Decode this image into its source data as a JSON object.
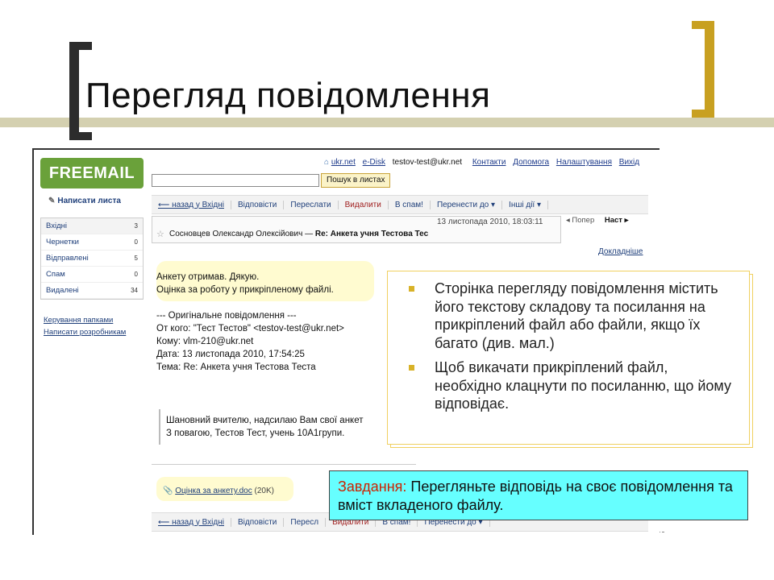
{
  "slide": {
    "title": "Перегляд повідомлення"
  },
  "webmail": {
    "logo": "FREEMAIL",
    "top_links": {
      "ukr": "ukr.net",
      "edisk": "e-Disk",
      "email": "testov-test@ukr.net",
      "contacts": "Контакти",
      "help": "Допомога",
      "settings": "Налаштування",
      "exit": "Вихід"
    },
    "search": {
      "value": "",
      "button": "Пошук в листах"
    },
    "compose": "Написати листа",
    "folders": [
      {
        "name": "Вхідні",
        "count": "3"
      },
      {
        "name": "Чернетки",
        "count": "0"
      },
      {
        "name": "Відправлені",
        "count": "5"
      },
      {
        "name": "Спам",
        "count": "0"
      },
      {
        "name": "Видалені",
        "count": "34"
      }
    ],
    "left_links": {
      "manage": "Керування папками",
      "write_dev": "Написати розробникам"
    },
    "toolbar": {
      "back": "⟵ назад у Вхідні",
      "reply": "Відповісти",
      "forward": "Переслати",
      "delete": "Видалити",
      "spam": "В спам!",
      "move": "Перенести до ▾",
      "other": "Інші дії ▾"
    },
    "toolbar_bottom": {
      "back": "⟵ назад у Вхідні",
      "reply": "Відповісти",
      "forward": "Пересл",
      "delete": "Видалити",
      "spam": "В спам!",
      "move": "Перенести до ▾"
    },
    "message": {
      "date": "13 листопада 2010, 18:03:11",
      "prev": "◂ Попер",
      "next": "Наст ▸",
      "sender": "Сосновцев Олександр Олексійович",
      "dash": " — ",
      "subject": "Re: Анкета учня Тестова Тес",
      "details": "Докладніше",
      "body_line1": "Анкету отримав. Дякую.",
      "body_line2": "Оцінка за роботу у прикріпленому файлі.",
      "orig_header": "--- Оригінальне повідомлення ---",
      "orig_from": "От кого: \"Тест Тестов\" <testov-test@ukr.net>",
      "orig_to": "Кому: vlm-210@ukr.net",
      "orig_date": "Дата: 13 листопада 2010, 17:54:25",
      "orig_subject": "Тема: Re: Анкета учня Тестова Теста",
      "quote_line1": "Шановний вчителю, надсилаю Вам свої анкет",
      "quote_line2": "З повагою, Тестов Тест, учень 10А1групи.",
      "attachment_name": "Оцінка за анкету.doc",
      "attachment_size": "(20K)"
    }
  },
  "callout": {
    "bullets": [
      "Сторінка перегляду повідомлення містить його текстову складову та посилання на прикріплений файл або файли, якщо їх багато (див. мал.)",
      "Щоб викачати прикріплений файл, необхідно клацнути по посиланню, що йому відповідає."
    ]
  },
  "task": {
    "label": "Завдання:",
    "text": " Перегляньте відповідь на своє повідомлення та вміст вкладеного файлу."
  },
  "colors": {
    "logo": "#6aa13a",
    "bracket_left": "#2c2c2c",
    "bracket_right": "#c8a021",
    "task_bg": "#66ffff",
    "task_label": "#cc2200",
    "bullet": "#d8b228"
  }
}
